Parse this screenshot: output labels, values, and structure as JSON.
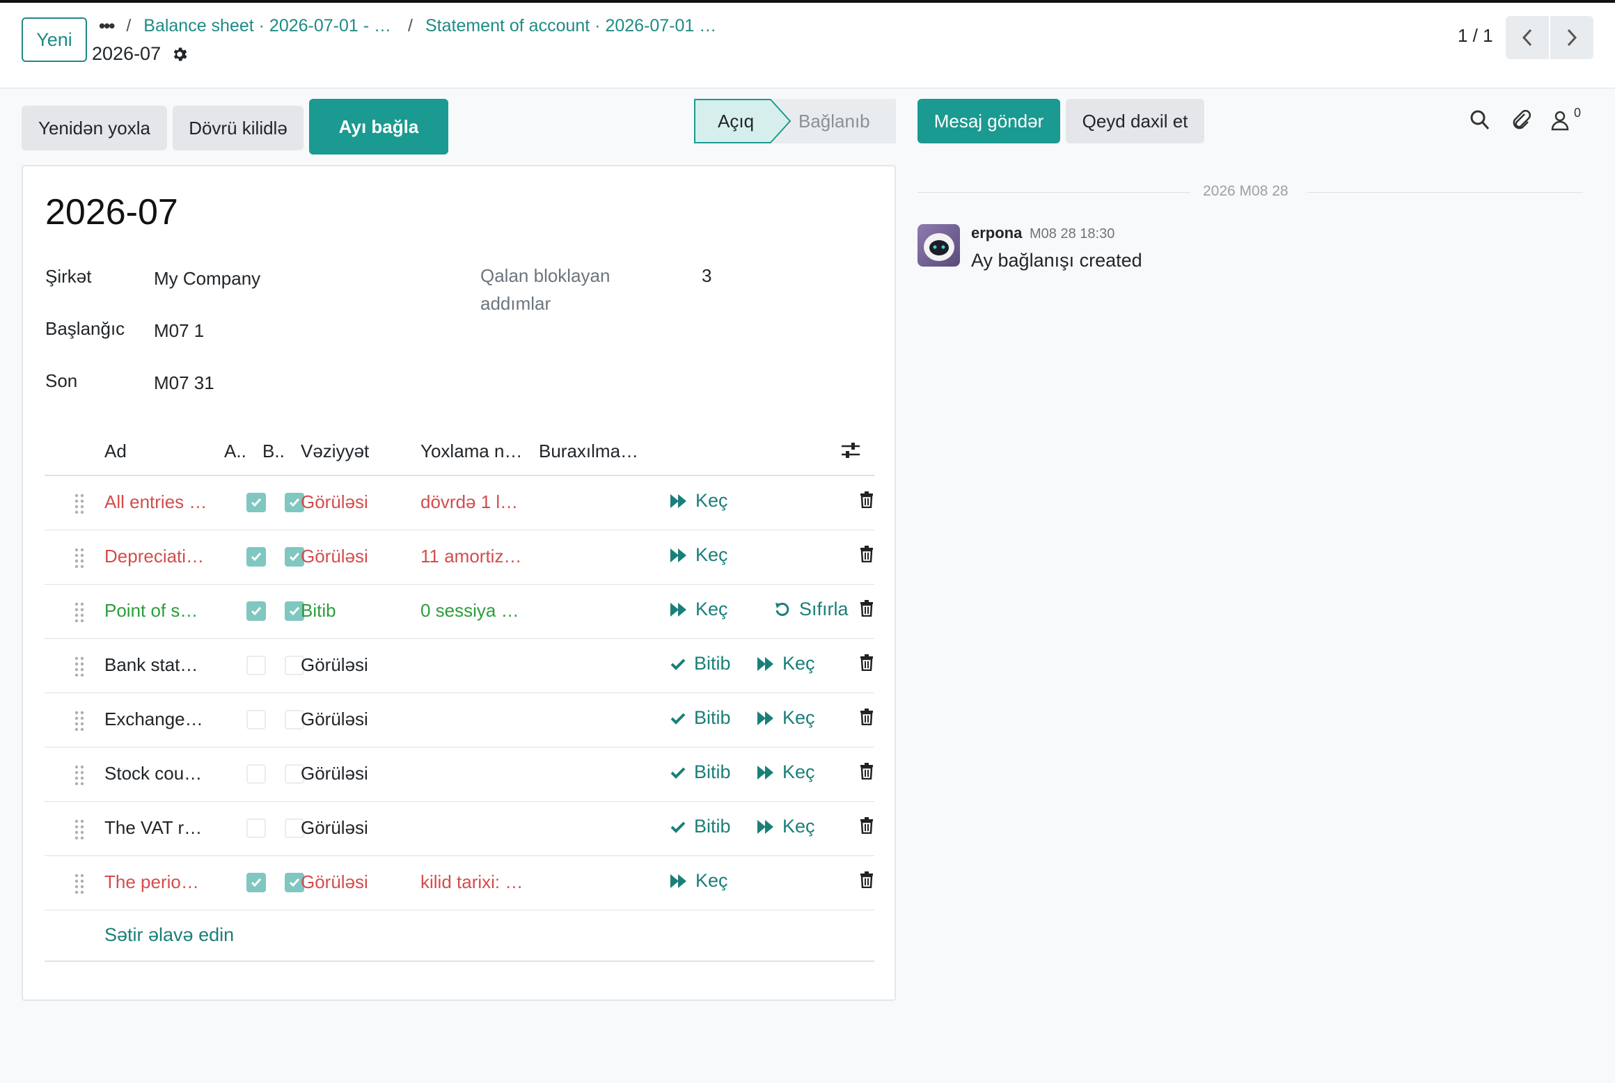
{
  "control_panel": {
    "new_button": "Yeni",
    "breadcrumb_dots": "•••",
    "breadcrumbs": [
      "Balance sheet · 2026-07-01 - …",
      "Statement of account · 2026-07-01 …"
    ],
    "separator": "/",
    "record_name": "2026-07",
    "settings_icon": "gear-icon",
    "pager": "1 / 1"
  },
  "actions": {
    "recheck": "Yenidən yoxla",
    "lock_period": "Dövrü kilidlə",
    "close_month": "Ayı bağla"
  },
  "statusbar": {
    "stages": [
      {
        "label": "Açıq",
        "active": true
      },
      {
        "label": "Bağlanıb",
        "active": false
      }
    ]
  },
  "form": {
    "title": "2026-07",
    "company_label": "Şirkət",
    "company_value": "My Company",
    "start_label": "Başlanğıc",
    "start_value": "M07 1",
    "end_label": "Son",
    "end_value": "M07 31",
    "blocking_label_1": "Qalan bloklayan",
    "blocking_label_2": "addımlar",
    "blocking_value": "3"
  },
  "table": {
    "headers": {
      "name": "Ad",
      "col_a": "A..",
      "col_b": "B..",
      "state": "Vəziyyət",
      "check_note": "Yoxlama n…",
      "skip_note": "Buraxılma…"
    },
    "rows": [
      {
        "name": "All entries …",
        "a": true,
        "b": true,
        "state": "Görüləsi",
        "note": "dövrdə 1 l…",
        "color": "red",
        "done_btn": "",
        "skip_btn": "Keç",
        "reset_btn": ""
      },
      {
        "name": "Depreciati…",
        "a": true,
        "b": true,
        "state": "Görüləsi",
        "note": "11 amortiz…",
        "color": "red",
        "done_btn": "",
        "skip_btn": "Keç",
        "reset_btn": ""
      },
      {
        "name": "Point of s…",
        "a": true,
        "b": true,
        "state": "Bitib",
        "note": "0 sessiya …",
        "color": "green",
        "done_btn": "",
        "skip_btn": "Keç",
        "reset_btn": "Sıfırla"
      },
      {
        "name": "Bank stat…",
        "a": false,
        "b": false,
        "state": "Görüləsi",
        "note": "",
        "color": "dark",
        "done_btn": "Bitib",
        "skip_btn": "Keç",
        "reset_btn": ""
      },
      {
        "name": "Exchange…",
        "a": false,
        "b": false,
        "state": "Görüləsi",
        "note": "",
        "color": "dark",
        "done_btn": "Bitib",
        "skip_btn": "Keç",
        "reset_btn": ""
      },
      {
        "name": "Stock cou…",
        "a": false,
        "b": false,
        "state": "Görüləsi",
        "note": "",
        "color": "dark",
        "done_btn": "Bitib",
        "skip_btn": "Keç",
        "reset_btn": ""
      },
      {
        "name": "The VAT r…",
        "a": false,
        "b": false,
        "state": "Görüləsi",
        "note": "",
        "color": "dark",
        "done_btn": "Bitib",
        "skip_btn": "Keç",
        "reset_btn": ""
      },
      {
        "name": "The perio…",
        "a": true,
        "b": true,
        "state": "Görüləsi",
        "note": "kilid tarixi: …",
        "color": "red",
        "done_btn": "",
        "skip_btn": "Keç",
        "reset_btn": ""
      }
    ],
    "add_line": "Sətir əlavə edin"
  },
  "chatter": {
    "send_message": "Mesaj göndər",
    "log_note": "Qeyd daxil et",
    "follower_count": "0",
    "date_separator": "2026 M08 28",
    "messages": [
      {
        "author": "erpona",
        "date": "M08 28 18:30",
        "body": "Ay bağlanışı created"
      }
    ]
  },
  "colors": {
    "primary": "#1a9a90",
    "link": "#1f8a84",
    "danger": "#d44c4c",
    "success": "#2b9d3b"
  }
}
